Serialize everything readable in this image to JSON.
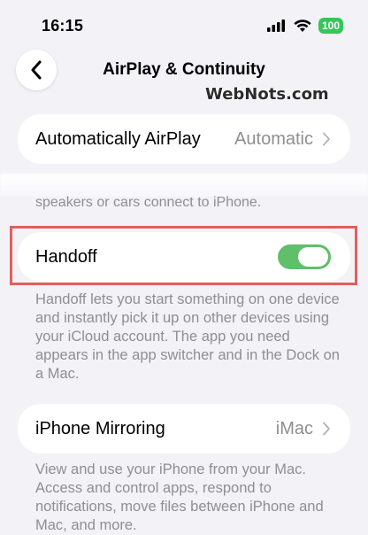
{
  "status_bar": {
    "time": "16:15",
    "battery": "100"
  },
  "nav": {
    "title": "AirPlay & Continuity"
  },
  "watermark": "WebNots.com",
  "airplay": {
    "label": "Automatically AirPlay",
    "value": "Automatic",
    "footer": "speakers or cars connect to iPhone."
  },
  "handoff": {
    "label": "Handoff",
    "enabled": true,
    "description": "Handoff lets you start something on one device and instantly pick it up on other devices using your iCloud account. The app you need appears in the app switcher and in the Dock on a Mac."
  },
  "mirroring": {
    "label": "iPhone Mirroring",
    "value": "iMac",
    "description": "View and use your iPhone from your Mac. Access and control apps, respond to notifications, move files between iPhone and Mac, and more."
  },
  "colors": {
    "toggle_on": "#5fbf6a",
    "highlight_border": "#e0605a",
    "background": "#f2f2f7"
  }
}
